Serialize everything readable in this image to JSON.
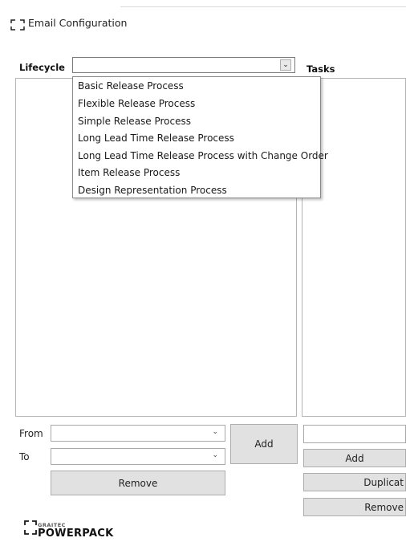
{
  "window": {
    "title": "Email Configuration",
    "icon": "bracket-frame-icon"
  },
  "lifecycle": {
    "label": "Lifecycle",
    "selected_value": "",
    "dropdown_options": [
      "Basic Release Process",
      "Flexible Release Process",
      "Simple Release Process",
      "Long Lead Time Release Process",
      "Long Lead Time Release Process with Change Order",
      "Item Release Process",
      "Design Representation Process"
    ]
  },
  "tasks": {
    "label": "Tasks",
    "add_label": "Add",
    "duplicate_label": "Duplicat",
    "remove_label": "Remove"
  },
  "transitions": {
    "from_label": "From",
    "to_label": "To",
    "from_value": "",
    "to_value": "",
    "add_label": "Add",
    "remove_label": "Remove"
  },
  "brand": {
    "company": "GRAITEC",
    "product": "POWERPACK"
  }
}
